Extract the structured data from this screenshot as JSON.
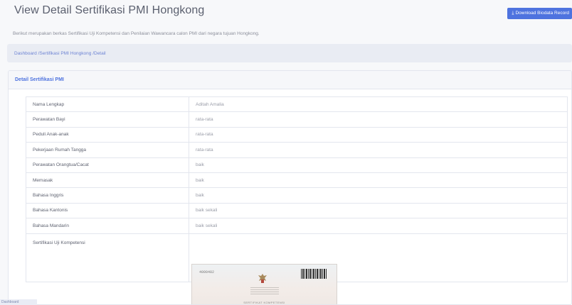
{
  "header": {
    "title": "View Detail Sertifikasi PMI Hongkong",
    "download_button": {
      "label": "Download Biodata Record",
      "icon": "download-icon"
    },
    "description": "Berikut merupakan berkas Sertifikasi Uji Kompetensi dan Penilaian Wawancara calon PMI dari negara tujuan Hongkong."
  },
  "breadcrumb": {
    "text": "Dashboard /Sertifikasi PMI Hongkong /Detail"
  },
  "card": {
    "title": "Detail Sertifikasi PMI",
    "rows": [
      {
        "label": "Nama Lengkap",
        "value": "Aditah Amalia"
      },
      {
        "label": "Perawatan Bayi",
        "value": "rata-rata"
      },
      {
        "label": "Peduli Anak-anak",
        "value": "rata-rata"
      },
      {
        "label": "Pekerjaan Rumah Tangga",
        "value": "rata-rata"
      },
      {
        "label": "Perawatan Orangtua/Cacat",
        "value": "baik"
      },
      {
        "label": "Memasak",
        "value": "baik"
      },
      {
        "label": "Bahasa Inggris",
        "value": "baik"
      },
      {
        "label": "Bahasa Kantonis",
        "value": "baik sekali"
      },
      {
        "label": "Bahasa Mandarin",
        "value": "baik sekali"
      }
    ],
    "certificate_label": "Sertifikasi Uji Kompetensi",
    "certificate_image": {
      "number": "4000482",
      "heading": "SERTIFIKAT KOMPETENSI"
    }
  },
  "corner_tag": "Dashboard",
  "colors": {
    "accent": "#4e73df",
    "breadcrumb_bg": "#e9ecf3",
    "page_bg": "#f7f8fa"
  }
}
